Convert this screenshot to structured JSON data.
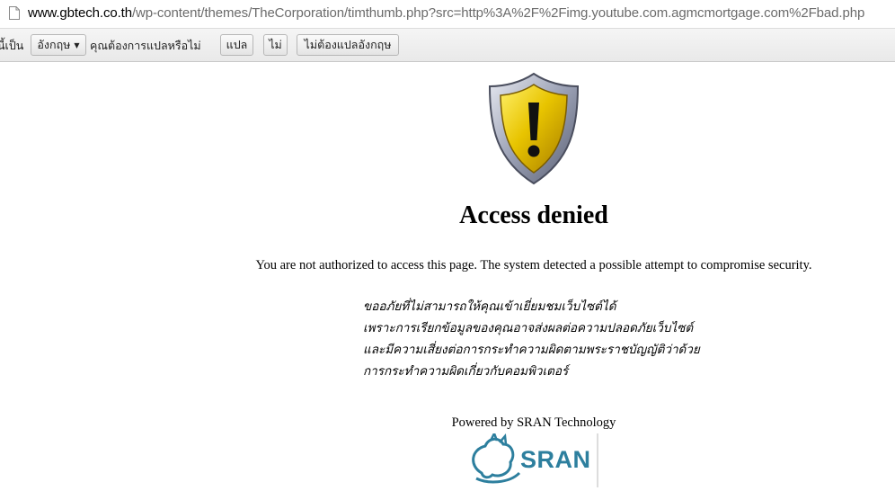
{
  "browser": {
    "address_bar": {
      "url_host": "www.gbtech.co.th",
      "url_path": "/wp-content/themes/TheCorporation/timthumb.php?src=http%3A%2F%2Fimg.youtube.com.agmcmortgage.com%2Fbad.php",
      "page_icon": "document-icon"
    },
    "translate_bar": {
      "prefix_text": "นี้เป็น",
      "language_select": "อังกฤษ",
      "question": "คุณต้องการแปลหรือไม่",
      "translate_button": "แปล",
      "no_button": "ไม่",
      "never_translate_button": "ไม่ต้องแปลอังกฤษ"
    }
  },
  "page": {
    "icon": "warning-shield-icon",
    "heading": "Access denied",
    "message": "You are not authorized to access this page. The system detected a possible attempt to compromise security.",
    "thai_notice": [
      "ขออภัยที่ไม่สามารถให้คุณเข้าเยี่ยมชมเว็บไซต์ได้",
      "เพราะการเรียกข้อมูลของคุณอาจส่งผลต่อความปลอดภัยเว็บไซต์",
      "และมีความเสี่ยงต่อการกระทำความผิดตามพระราชบัญญัติว่าด้วย",
      "การกระทำความผิดเกี่ยวกับคอมพิวเตอร์"
    ],
    "powered_by": "Powered by SRAN Technology",
    "logo_text": "SRAN",
    "colors": {
      "shield_gold": "#e8c400",
      "shield_silver": "#9aa0b4",
      "logo_blue": "#2d7f9e"
    }
  }
}
